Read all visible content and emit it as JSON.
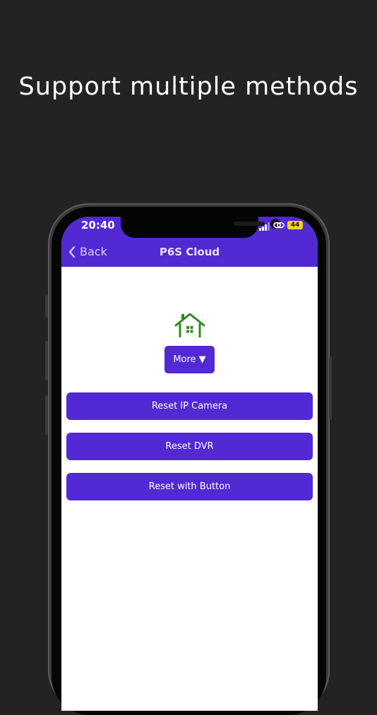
{
  "promo": {
    "headline": "Support multiple methods"
  },
  "status_bar": {
    "time": "20:40",
    "battery": "44"
  },
  "nav": {
    "back_label": "Back",
    "title": "P6S Cloud"
  },
  "content": {
    "icon": "house-icon",
    "more_label": "More ▼",
    "buttons": [
      {
        "label": "Reset IP Camera"
      },
      {
        "label": "Reset DVR"
      },
      {
        "label": "Reset with Button"
      }
    ]
  },
  "colors": {
    "background": "#232323",
    "accent": "#5229d3",
    "house": "#2e8b1f"
  }
}
